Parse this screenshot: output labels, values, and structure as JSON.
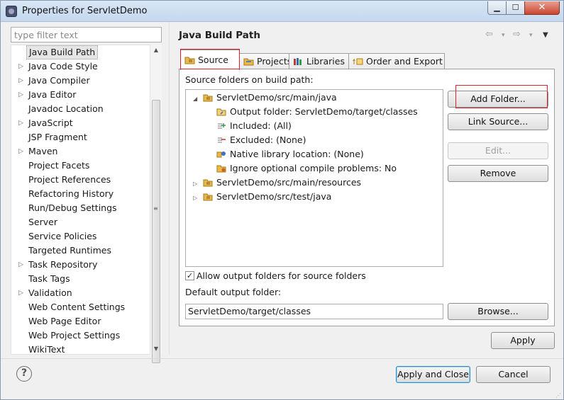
{
  "window": {
    "title": "Properties for ServletDemo",
    "min_glyph": "▁",
    "max_glyph": "☐",
    "close_glyph": "✕"
  },
  "filter": {
    "placeholder": "type filter text"
  },
  "nav_tree": {
    "items": [
      {
        "label": "Java Build Path",
        "expandable": false,
        "selected": true
      },
      {
        "label": "Java Code Style",
        "expandable": true
      },
      {
        "label": "Java Compiler",
        "expandable": true
      },
      {
        "label": "Java Editor",
        "expandable": true
      },
      {
        "label": "Javadoc Location",
        "expandable": false
      },
      {
        "label": "JavaScript",
        "expandable": true
      },
      {
        "label": "JSP Fragment",
        "expandable": false
      },
      {
        "label": "Maven",
        "expandable": true
      },
      {
        "label": "Project Facets",
        "expandable": false
      },
      {
        "label": "Project References",
        "expandable": false
      },
      {
        "label": "Refactoring History",
        "expandable": false
      },
      {
        "label": "Run/Debug Settings",
        "expandable": false
      },
      {
        "label": "Server",
        "expandable": false
      },
      {
        "label": "Service Policies",
        "expandable": false
      },
      {
        "label": "Targeted Runtimes",
        "expandable": false
      },
      {
        "label": "Task Repository",
        "expandable": true
      },
      {
        "label": "Task Tags",
        "expandable": false
      },
      {
        "label": "Validation",
        "expandable": true
      },
      {
        "label": "Web Content Settings",
        "expandable": false
      },
      {
        "label": "Web Page Editor",
        "expandable": false
      },
      {
        "label": "Web Project Settings",
        "expandable": false
      },
      {
        "label": "WikiText",
        "expandable": false
      }
    ]
  },
  "page": {
    "title": "Java Build Path",
    "nav": {
      "back": "⇦",
      "forward": "⇨",
      "dropdown": "▾",
      "menu": "▼"
    },
    "tabs": [
      {
        "label": "Source",
        "icon": "source-folder-icon"
      },
      {
        "label": "Projects",
        "icon": "projects-icon"
      },
      {
        "label": "Libraries",
        "icon": "libraries-icon"
      },
      {
        "label": "Order and Export",
        "icon": "order-export-icon"
      }
    ],
    "source_label": "Source folders on build path:",
    "tree": [
      {
        "label": "ServletDemo/src/main/java",
        "expanded": true
      },
      {
        "label": "Output folder: ServletDemo/target/classes"
      },
      {
        "label": "Included: (All)"
      },
      {
        "label": "Excluded: (None)"
      },
      {
        "label": "Native library location: (None)"
      },
      {
        "label": "Ignore optional compile problems: No"
      },
      {
        "label": "ServletDemo/src/main/resources",
        "expanded": false
      },
      {
        "label": "ServletDemo/src/test/java",
        "expanded": false
      }
    ],
    "buttons": {
      "add_folder": "Add Folder...",
      "link_source": "Link Source...",
      "edit": "Edit...",
      "remove": "Remove",
      "browse": "Browse..."
    },
    "allow_output_label": "Allow output folders for source folders",
    "allow_output_checked": true,
    "default_output_label": "Default output folder:",
    "default_output_value": "ServletDemo/target/classes",
    "apply": "Apply"
  },
  "footer": {
    "help": "?",
    "apply_close": "Apply and Close",
    "cancel": "Cancel"
  },
  "colors": {
    "highlight_red": "#e2232a",
    "folder_yellow": "#e9b949"
  }
}
